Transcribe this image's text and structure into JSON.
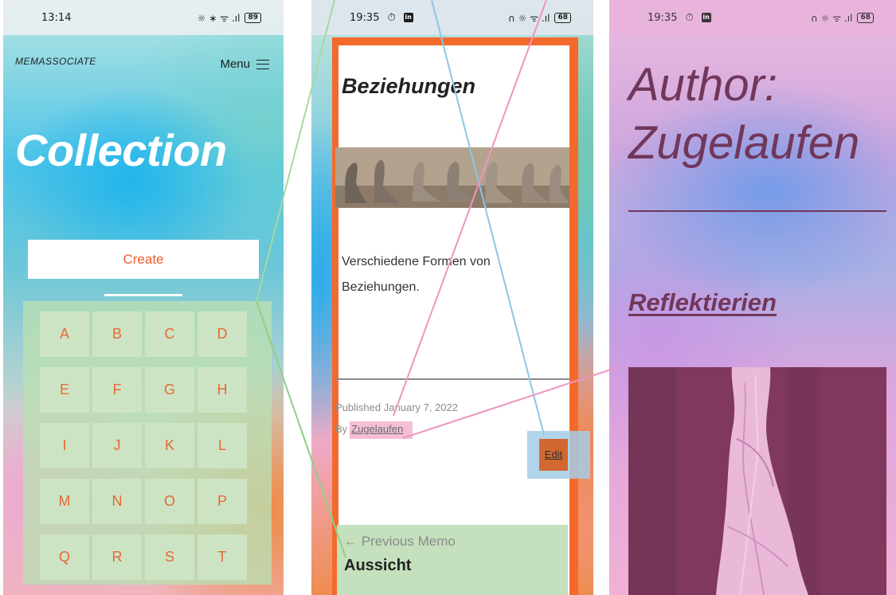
{
  "phone1": {
    "status": {
      "time": "13:14",
      "icons": "☼ ∗ ᯤ .ıl",
      "battery": "89"
    },
    "logo": "MEMASSOCIATE",
    "menu_label": "Menu",
    "heading": "Collection",
    "create_label": "Create",
    "letters": [
      "A",
      "B",
      "C",
      "D",
      "E",
      "F",
      "G",
      "H",
      "I",
      "J",
      "K",
      "L",
      "M",
      "N",
      "O",
      "P",
      "Q",
      "R",
      "S",
      "T"
    ]
  },
  "phone2": {
    "status": {
      "time": "19:35",
      "icons": "∩ ☼ ᯤ .ıl",
      "battery": "68",
      "left_icon_1": "⏱",
      "left_icon_2": "in"
    },
    "post_title": "Beziehungen",
    "excerpt": "Verschiedene Formen von Beziehungen.",
    "published": "Published January 7, 2022",
    "by_prefix": "By",
    "author": "Zugelaufen",
    "edit_label": "Edit",
    "prev_label": "← Previous Memo",
    "prev_title": "Aussicht"
  },
  "phone3": {
    "status": {
      "time": "19:35",
      "icons": "∩ ☼ ᯤ .ıl",
      "battery": "68",
      "left_icon_1": "⏱",
      "left_icon_2": "in"
    },
    "author_line1": "Author:",
    "author_line2": "Zugelaufen",
    "category": "Reflektierien"
  },
  "colors": {
    "accent_orange": "#f36a2c",
    "overlay_green": "#c4e0bd",
    "overlay_pink": "#f4bfd6",
    "overlay_blue": "#a5cce6",
    "plum": "#5a2243"
  },
  "icons": [
    "hamburger-menu-icon",
    "left-arrow-icon",
    "wifi-icon",
    "signal-icon",
    "battery-icon",
    "headphones-icon",
    "mute-icon",
    "bluetooth-icon",
    "alarm-icon",
    "linkedin-icon"
  ]
}
